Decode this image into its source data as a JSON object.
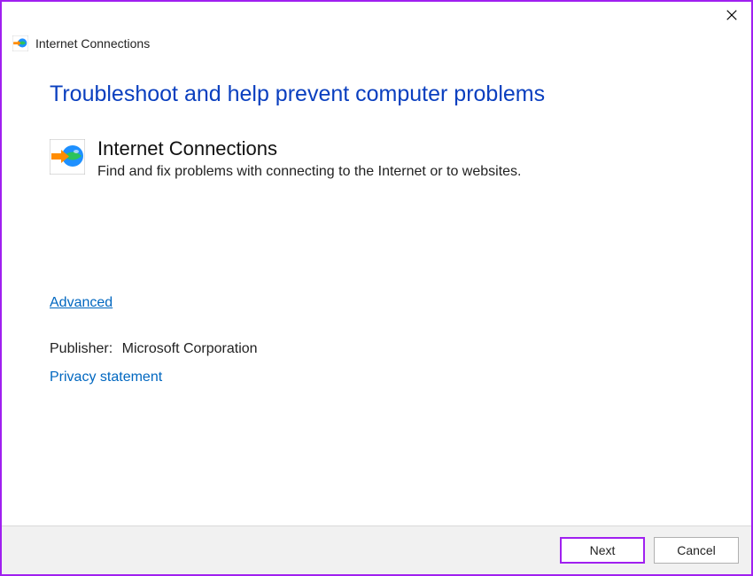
{
  "titleBar": {
    "close": "✕"
  },
  "tabHeader": {
    "title": "Internet Connections"
  },
  "page": {
    "title": "Troubleshoot and help prevent computer problems"
  },
  "troubleshooter": {
    "name": "Internet Connections",
    "description": "Find and fix problems with connecting to the Internet or to websites."
  },
  "links": {
    "advanced": "Advanced",
    "privacy": "Privacy statement"
  },
  "publisher": {
    "label": "Publisher:",
    "value": "Microsoft Corporation"
  },
  "footer": {
    "next": "Next",
    "cancel": "Cancel"
  }
}
